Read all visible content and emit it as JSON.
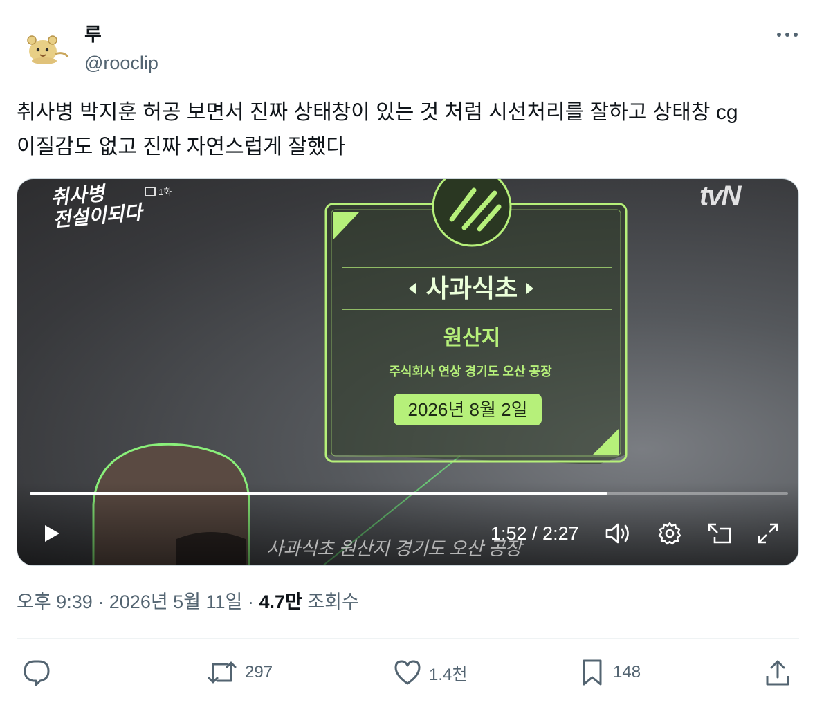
{
  "author": {
    "display_name": "루",
    "handle": "@rooclip",
    "avatar_icon": "hamster-avatar"
  },
  "tweet": {
    "text_line1": "취사병 박지훈 허공 보면서 진짜 상태창이 있는 것 처럼 시선처리를 잘하고 상태창 cg",
    "text_line2": "이질감도 없고 진짜 자연스럽게 잘했다"
  },
  "video": {
    "show_logo_line1": "취사병",
    "show_logo_line2": "전설이되다",
    "episode": "1화",
    "channel_logo": "tvN",
    "status_window": {
      "title": "사과식초",
      "section_label": "원산지",
      "origin": "주식회사 연상 경기도 오산 공장",
      "date": "2026년 8월 2일"
    },
    "subtitle": "사과식초 원산지 경기도 오산 공장",
    "time_display": "1:52 / 2:27",
    "progress_fraction": 0.762
  },
  "meta": {
    "time": "오후 9:39",
    "separator": "·",
    "date": "2026년 5월 11일",
    "views": "4.7만",
    "views_label": "조회수"
  },
  "actions": {
    "reply_count": "",
    "retweet_count": "297",
    "like_count": "1.4천",
    "bookmark_count": "148"
  },
  "colors": {
    "text_primary": "#0f1419",
    "text_secondary": "#536471",
    "hud_green": "#b6f07a"
  }
}
